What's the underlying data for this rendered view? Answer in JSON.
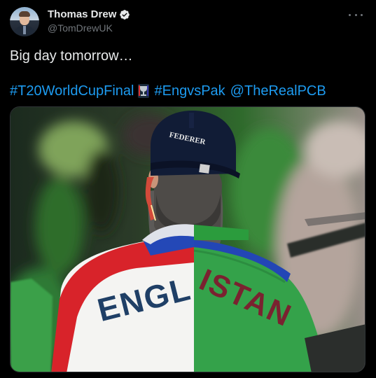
{
  "tweet": {
    "author_name": "Thomas Drew",
    "author_handle": "@TomDrewUK",
    "verified": true,
    "text": "Big day tomorrow…",
    "hashtags": [
      {
        "text": "#T20WorldCupFinal"
      },
      {
        "text": "#EngvsPak"
      },
      {
        "text": "@TheRealPCB"
      }
    ]
  },
  "media": {
    "cap_text": "FEDERER",
    "shirt_left_text": "ENGL",
    "shirt_right_text": "ISTAN"
  },
  "icons": {
    "verified": "verified-badge-icon",
    "more": "more-horizontal-icon",
    "trophy": "trophy-emoji-icon"
  },
  "colors": {
    "background": "#000000",
    "text": "#e7e9ea",
    "secondary": "#71767b",
    "link": "#1d9bf0"
  }
}
